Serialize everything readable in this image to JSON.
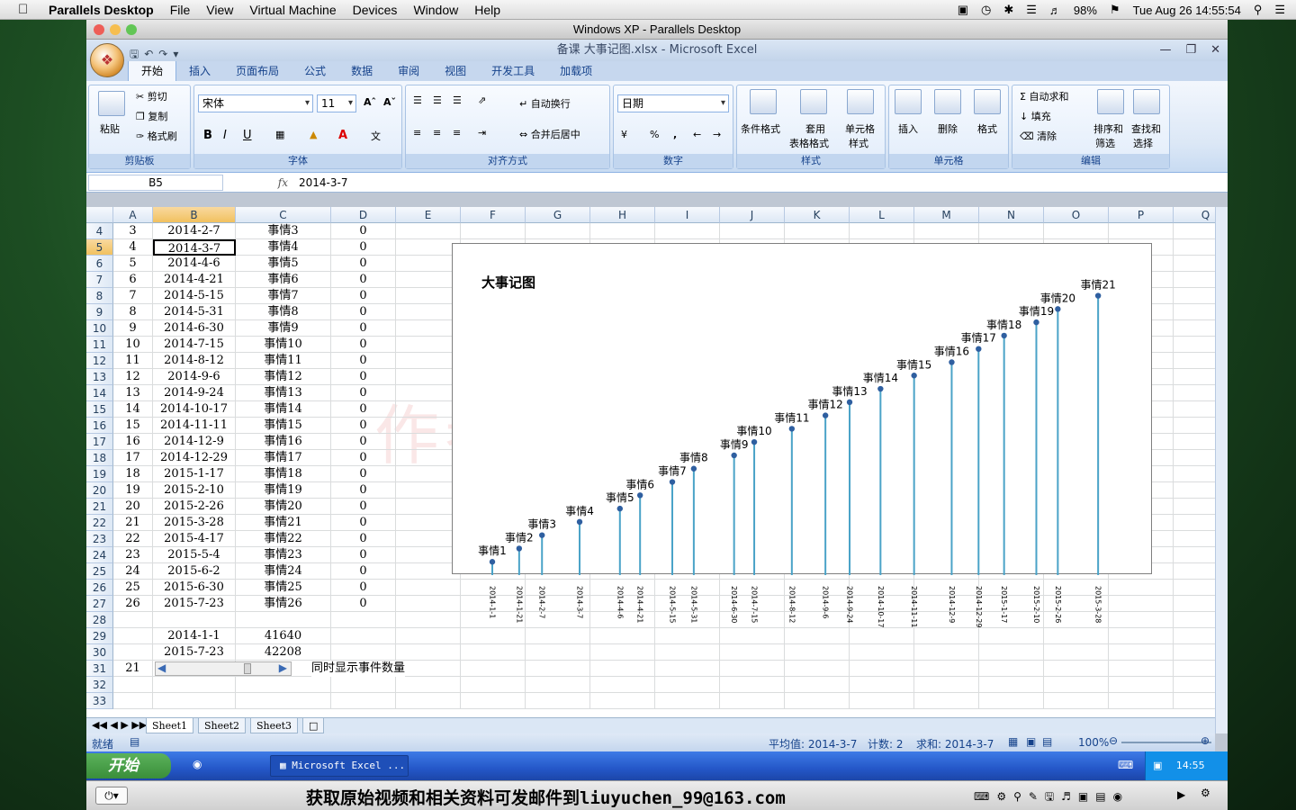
{
  "menubar": {
    "app": "Parallels Desktop",
    "items": [
      "File",
      "View",
      "Virtual Machine",
      "Devices",
      "Window",
      "Help"
    ],
    "battery": "98%",
    "clock": "Tue Aug 26  14:55:54"
  },
  "parallels_title": "Windows XP - Parallels Desktop",
  "excel": {
    "title": "备课 大事记图.xlsx - Microsoft Excel",
    "tabs": [
      "开始",
      "插入",
      "页面布局",
      "公式",
      "数据",
      "审阅",
      "视图",
      "开发工具",
      "加载项"
    ],
    "ribbon": {
      "clipboard": {
        "label": "剪贴板",
        "paste": "粘贴",
        "cut": "剪切",
        "copy": "复制",
        "painter": "格式刷"
      },
      "font": {
        "label": "字体",
        "name": "宋体",
        "size": "11"
      },
      "align": {
        "label": "对齐方式",
        "wrap": "自动换行",
        "merge": "合并后居中"
      },
      "number": {
        "label": "数字",
        "format": "日期"
      },
      "styles": {
        "label": "样式",
        "cond": "条件格式",
        "table1": "套用",
        "table2": "表格格式",
        "cell1": "单元格",
        "cell2": "样式"
      },
      "cells": {
        "label": "单元格",
        "insert": "插入",
        "delete": "删除",
        "format": "格式"
      },
      "edit": {
        "label": "编辑",
        "autosum": "自动求和",
        "fill": "填充",
        "clear": "清除",
        "sort1": "排序和",
        "sort2": "筛选",
        "find1": "查找和",
        "find2": "选择"
      }
    },
    "namebox": "B5",
    "formula": "2014-3-7",
    "columns": [
      "A",
      "B",
      "C",
      "D",
      "E",
      "F",
      "G",
      "H",
      "I",
      "J",
      "K",
      "L",
      "M",
      "N",
      "O",
      "P",
      "Q"
    ],
    "rows": [
      {
        "n": "4",
        "a": "3",
        "b": "2014-2-7",
        "c": "事情3",
        "d": "0"
      },
      {
        "n": "5",
        "a": "4",
        "b": "2014-3-7",
        "c": "事情4",
        "d": "0"
      },
      {
        "n": "6",
        "a": "5",
        "b": "2014-4-6",
        "c": "事情5",
        "d": "0"
      },
      {
        "n": "7",
        "a": "6",
        "b": "2014-4-21",
        "c": "事情6",
        "d": "0"
      },
      {
        "n": "8",
        "a": "7",
        "b": "2014-5-15",
        "c": "事情7",
        "d": "0"
      },
      {
        "n": "9",
        "a": "8",
        "b": "2014-5-31",
        "c": "事情8",
        "d": "0"
      },
      {
        "n": "10",
        "a": "9",
        "b": "2014-6-30",
        "c": "事情9",
        "d": "0"
      },
      {
        "n": "11",
        "a": "10",
        "b": "2014-7-15",
        "c": "事情10",
        "d": "0"
      },
      {
        "n": "12",
        "a": "11",
        "b": "2014-8-12",
        "c": "事情11",
        "d": "0"
      },
      {
        "n": "13",
        "a": "12",
        "b": "2014-9-6",
        "c": "事情12",
        "d": "0"
      },
      {
        "n": "14",
        "a": "13",
        "b": "2014-9-24",
        "c": "事情13",
        "d": "0"
      },
      {
        "n": "15",
        "a": "14",
        "b": "2014-10-17",
        "c": "事情14",
        "d": "0"
      },
      {
        "n": "16",
        "a": "15",
        "b": "2014-11-11",
        "c": "事情15",
        "d": "0"
      },
      {
        "n": "17",
        "a": "16",
        "b": "2014-12-9",
        "c": "事情16",
        "d": "0"
      },
      {
        "n": "18",
        "a": "17",
        "b": "2014-12-29",
        "c": "事情17",
        "d": "0"
      },
      {
        "n": "19",
        "a": "18",
        "b": "2015-1-17",
        "c": "事情18",
        "d": "0"
      },
      {
        "n": "20",
        "a": "19",
        "b": "2015-2-10",
        "c": "事情19",
        "d": "0"
      },
      {
        "n": "21",
        "a": "20",
        "b": "2015-2-26",
        "c": "事情20",
        "d": "0"
      },
      {
        "n": "22",
        "a": "21",
        "b": "2015-3-28",
        "c": "事情21",
        "d": "0"
      },
      {
        "n": "23",
        "a": "22",
        "b": "2015-4-17",
        "c": "事情22",
        "d": "0"
      },
      {
        "n": "24",
        "a": "23",
        "b": "2015-5-4",
        "c": "事情23",
        "d": "0"
      },
      {
        "n": "25",
        "a": "24",
        "b": "2015-6-2",
        "c": "事情24",
        "d": "0"
      },
      {
        "n": "26",
        "a": "25",
        "b": "2015-6-30",
        "c": "事情25",
        "d": "0"
      },
      {
        "n": "27",
        "a": "26",
        "b": "2015-7-23",
        "c": "事情26",
        "d": "0"
      },
      {
        "n": "28",
        "a": "",
        "b": "",
        "c": "",
        "d": ""
      },
      {
        "n": "29",
        "a": "",
        "b": "2014-1-1",
        "c": "41640",
        "d": ""
      },
      {
        "n": "30",
        "a": "",
        "b": "2015-7-23",
        "c": "42208",
        "d": ""
      },
      {
        "n": "31",
        "a": "21",
        "b": "",
        "c": "",
        "d": ""
      },
      {
        "n": "32",
        "a": "",
        "b": "",
        "c": "",
        "d": ""
      },
      {
        "n": "33",
        "a": "",
        "b": "",
        "c": "",
        "d": ""
      }
    ],
    "scroll_label": "同时显示事件数量",
    "watermark": "作者：  刘雨辰99",
    "sheets": [
      "Sheet1",
      "Sheet2",
      "Sheet3"
    ],
    "status": {
      "ready": "就绪",
      "avg": "平均值: 2014-3-7",
      "count": "计数: 2",
      "sum": "求和: 2014-3-7",
      "zoom": "100%"
    }
  },
  "chart_data": {
    "type": "stem",
    "title": "大事记图",
    "categories": [
      "2014-1-1",
      "2014-1-21",
      "2014-2-7",
      "2014-3-7",
      "2014-4-6",
      "2014-4-21",
      "2014-5-15",
      "2014-5-31",
      "2014-6-30",
      "2014-7-15",
      "2014-8-12",
      "2014-9-6",
      "2014-9-24",
      "2014-10-17",
      "2014-11-11",
      "2014-12-9",
      "2014-12-29",
      "2015-1-17",
      "2015-2-10",
      "2015-2-26",
      "2015-3-28"
    ],
    "labels": [
      "事情1",
      "事情2",
      "事情3",
      "事情4",
      "事情5",
      "事情6",
      "事情7",
      "事情8",
      "事情9",
      "事情10",
      "事情11",
      "事情12",
      "事情13",
      "事情14",
      "事情15",
      "事情16",
      "事情17",
      "事情18",
      "事情19",
      "事情20",
      "事情21"
    ],
    "values": [
      1,
      2,
      3,
      4,
      5,
      6,
      7,
      8,
      9,
      10,
      11,
      12,
      13,
      14,
      15,
      16,
      17,
      18,
      19,
      20,
      21
    ],
    "xlim": [
      "2014-1-1",
      "2015-4-15"
    ],
    "ylim": [
      0,
      23
    ]
  },
  "xp": {
    "start": "开始",
    "task": "Microsoft Excel ...",
    "clock": "14:55"
  },
  "footer_text": "获取原始视频和相关资料可发邮件到liuyuchen_99@163.com",
  "colors": {
    "stem": "#4aa3c8",
    "dot": "#2f5fa0",
    "accent": "#15428b"
  }
}
